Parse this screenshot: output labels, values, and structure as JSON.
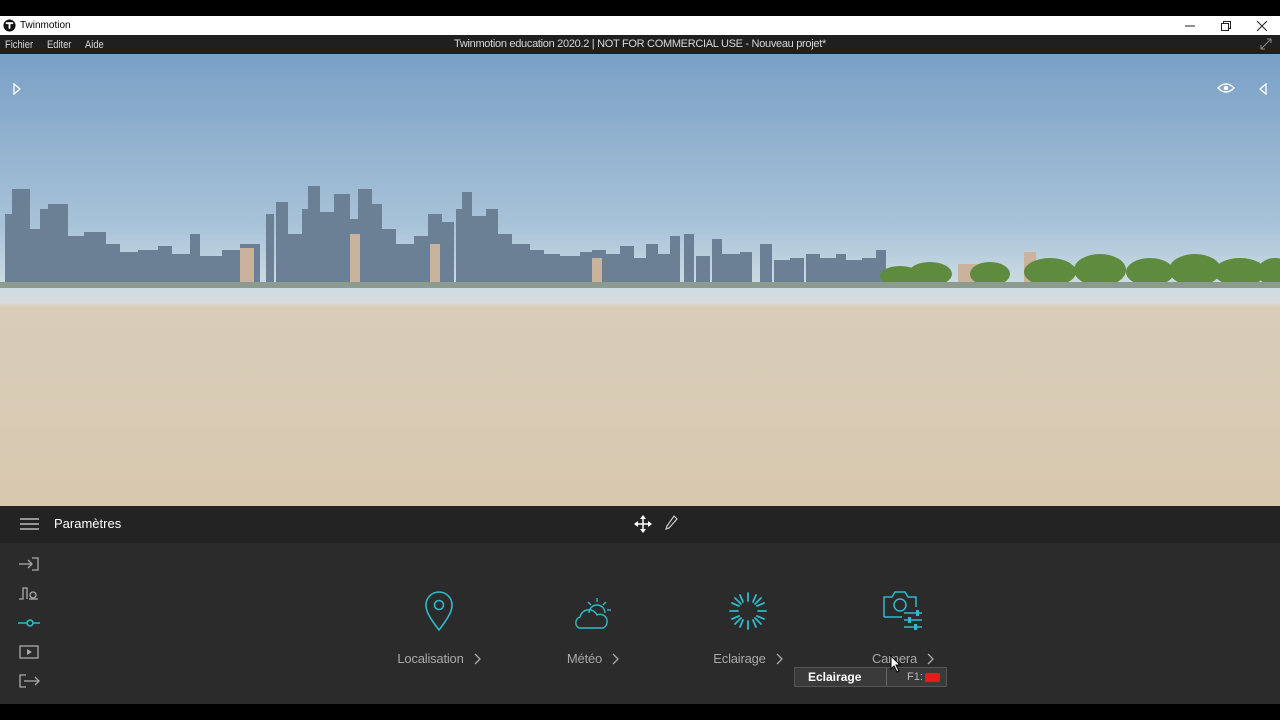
{
  "window": {
    "app_name": "Twinmotion",
    "minimize_icon": "minimize-icon",
    "restore_icon": "restore-icon",
    "close_icon": "close-icon"
  },
  "menubar": {
    "items": [
      "Fichier",
      "Editer",
      "Aide"
    ],
    "document_title": "Twinmotion education 2020.2 | NOT FOR COMMERCIAL USE - Nouveau projet*"
  },
  "viewport": {
    "left_toggle_icon": "play-right-icon",
    "eye_icon": "eye-icon",
    "right_toggle_icon": "play-left-icon"
  },
  "toolbar": {
    "title": "Paramètres",
    "menu_icon": "hamburger-icon",
    "move_icon": "move-arrows-icon",
    "pen_icon": "pen-icon"
  },
  "sidebar": {
    "icons": [
      "import-icon",
      "context-icon",
      "settings-sliders-icon",
      "media-icon",
      "export-icon"
    ],
    "active_index": 2
  },
  "tiles": [
    {
      "label": "Localisation",
      "icon": "location-pin-icon"
    },
    {
      "label": "Météo",
      "icon": "weather-icon"
    },
    {
      "label": "Eclairage",
      "icon": "lighting-icon"
    },
    {
      "label": "Camera",
      "icon": "camera-settings-icon"
    }
  ],
  "tooltip": {
    "label": "Eclairage",
    "shortcut": "F1:"
  },
  "colors": {
    "accent": "#2fb9c9",
    "panel_bg": "#2b2b2b",
    "toolbar_bg": "#232323",
    "badge": "#e21b1b"
  }
}
